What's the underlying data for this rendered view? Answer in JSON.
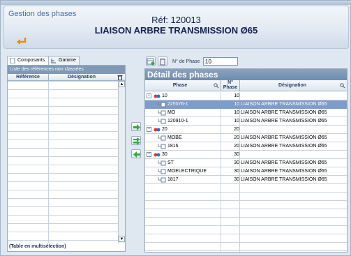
{
  "header": {
    "title": "Gestion des phases",
    "reference": "Réf: 120013",
    "subtitle": "LIAISON ARBRE TRANSMISSION Ø65"
  },
  "left": {
    "tabs": [
      "Composants",
      "Gamme"
    ],
    "list_title": "Liste des références non classées",
    "columns": [
      "Référence",
      "Désignation"
    ],
    "footer": "(Table en multisélection)"
  },
  "right": {
    "phase_label": "N° de Phase",
    "phase_value": "10",
    "title": "Détail des phases",
    "columns": {
      "phase": "Phase",
      "num": "N° Phase",
      "designation": "Désignation"
    },
    "rows": [
      {
        "phase": "10",
        "num": "10",
        "des": ""
      },
      {
        "phase": "225076-1",
        "num": "10",
        "des": "LIAISON ARBRE TRANSMISSION Ø65"
      },
      {
        "phase": "MO",
        "num": "10",
        "des": "LIAISON ARBRE TRANSMISSION Ø65"
      },
      {
        "phase": "120910-1",
        "num": "10",
        "des": "LIAISON ARBRE TRANSMISSION Ø65"
      },
      {
        "phase": "20",
        "num": "20",
        "des": ""
      },
      {
        "phase": "MOBE",
        "num": "20",
        "des": "LIAISON ARBRE TRANSMISSION Ø65"
      },
      {
        "phase": "1816",
        "num": "20",
        "des": "LIAISON ARBRE TRANSMISSION Ø65"
      },
      {
        "phase": "30",
        "num": "30",
        "des": ""
      },
      {
        "phase": "ST",
        "num": "30",
        "des": "LIAISON ARBRE TRANSMISSION Ø65"
      },
      {
        "phase": "MOELECTRIQUE",
        "num": "30",
        "des": "LIAISON ARBRE TRANSMISSION Ø65"
      },
      {
        "phase": "1817",
        "num": "30",
        "des": "LIAISON ARBRE TRANSMISSION Ø65"
      }
    ]
  },
  "colors": {
    "accent": "#4a6ea8",
    "selection": "#7d9cc8",
    "panel_header": "#7e98b6"
  }
}
